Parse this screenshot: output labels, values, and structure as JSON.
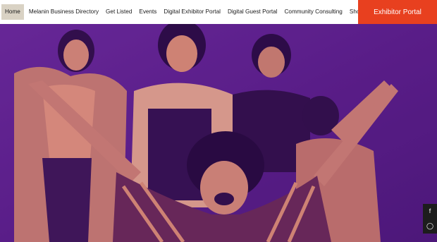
{
  "nav": {
    "items": [
      {
        "label": "Home",
        "active": true
      },
      {
        "label": "Melanin Business Directory"
      },
      {
        "label": "Get Listed"
      },
      {
        "label": "Events"
      },
      {
        "label": "Digital Exhibitor Portal"
      },
      {
        "label": "Digital Guest Portal"
      },
      {
        "label": "Community Consulting"
      },
      {
        "label": "Shop"
      }
    ],
    "cta_label": "Exhibitor Portal"
  },
  "hero": {
    "image": "photo of a group of smiling women with purple-orange duotone overlay"
  },
  "social": {
    "icons": [
      "facebook-icon",
      "instagram-icon"
    ]
  },
  "colors": {
    "cta": "#e8401f",
    "overlay_purple": "#5b1f8c",
    "overlay_orange": "#e2906a",
    "active_tab": "#d9d2c4"
  }
}
